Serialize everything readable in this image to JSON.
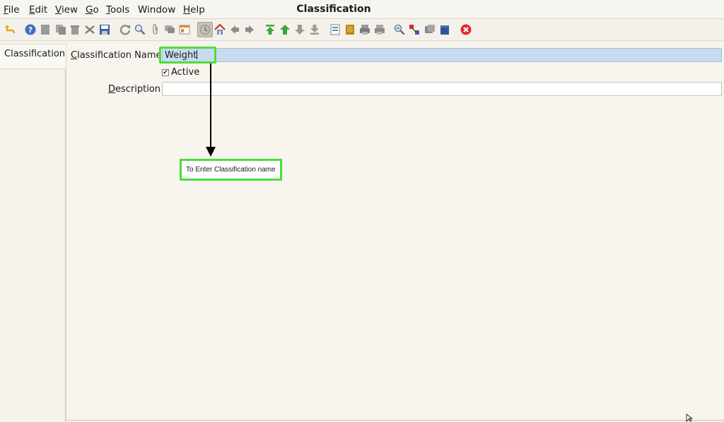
{
  "menu": {
    "file": "File",
    "edit": "Edit",
    "view": "View",
    "go": "Go",
    "tools": "Tools",
    "window": "Window",
    "help": "Help"
  },
  "window": {
    "title": "Classification"
  },
  "tabs": [
    {
      "label": "Classification"
    }
  ],
  "form": {
    "name_label": "Classification Name",
    "name_value": "Weight",
    "active_label": "Active",
    "active_checked": true,
    "description_label": "Description",
    "description_value": ""
  },
  "annotation": {
    "callout_text": "To Enter Classification name"
  },
  "colors": {
    "highlight": "#4cdc3c",
    "selected_field": "#c9dbef",
    "close_red": "#e02b2b"
  }
}
